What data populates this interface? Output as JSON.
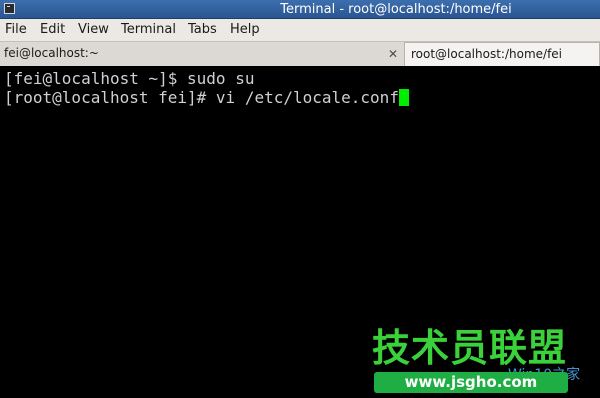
{
  "window": {
    "title": "Terminal - root@localhost:/home/fei"
  },
  "menu": {
    "items": [
      "File",
      "Edit",
      "View",
      "Terminal",
      "Tabs",
      "Help"
    ]
  },
  "tabs": [
    {
      "label": "fei@localhost:~",
      "active": false
    },
    {
      "label": "root@localhost:/home/fei",
      "active": true
    }
  ],
  "terminal": {
    "lines": [
      "[fei@localhost ~]$ sudo su",
      "[root@localhost fei]# vi /etc/locale.conf"
    ],
    "cursor_color": "#00ee00"
  },
  "watermark": {
    "brand": "技术员联盟",
    "url": "www.jsgho.com",
    "sub": "Win10之家"
  },
  "colors": {
    "titlebar": "#2f5f9e",
    "terminal_bg": "#000000",
    "terminal_fg": "#d0d0d0",
    "watermark_green": "#1fae43"
  }
}
